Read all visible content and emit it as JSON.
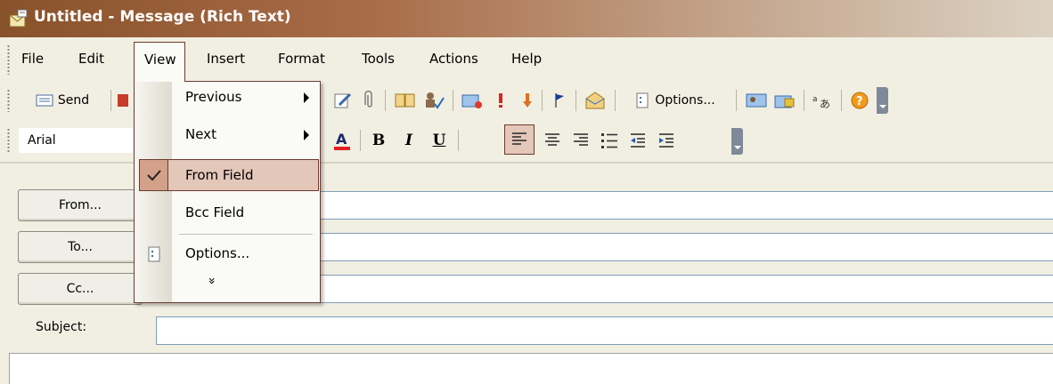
{
  "window": {
    "title": "Untitled - Message (Rich Text)"
  },
  "menubar": {
    "items": [
      "File",
      "Edit",
      "View",
      "Insert",
      "Format",
      "Tools",
      "Actions",
      "Help"
    ]
  },
  "toolbar1": {
    "send_label": "Send",
    "options_label": "Options..."
  },
  "toolbar2": {
    "font_name": "Arial",
    "bold": "B",
    "italic": "I",
    "underline": "U"
  },
  "view_menu": {
    "items": [
      {
        "label": "Previous",
        "submenu": true
      },
      {
        "label": "Next",
        "submenu": true
      },
      {
        "label": "From Field",
        "checked": true,
        "highlighted": true
      },
      {
        "label": "Bcc Field"
      },
      {
        "label": "Options..."
      }
    ],
    "expand_glyph": "»"
  },
  "form": {
    "from_button": "From...",
    "to_button": "To...",
    "cc_button": "Cc...",
    "subject_label": "Subject:"
  },
  "colors": {
    "title_start": "#88522a",
    "menu_bg": "#f1efe2",
    "highlight": "#e3c7b8",
    "highlight_border": "#6b3b2f"
  }
}
